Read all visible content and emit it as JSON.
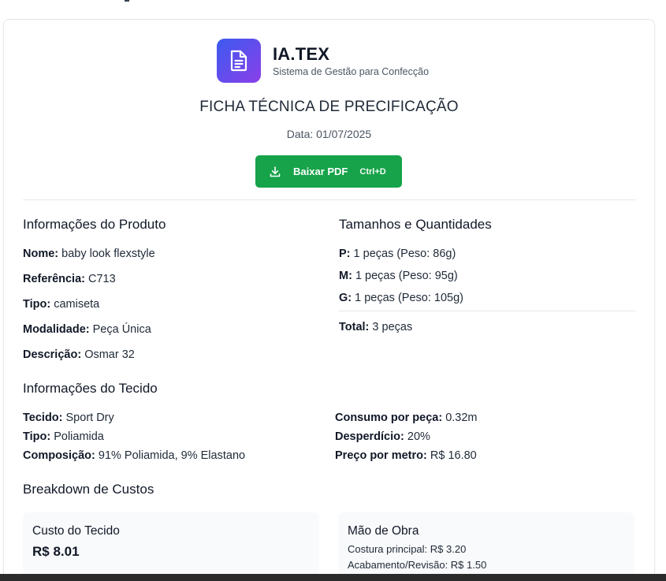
{
  "brand": {
    "name": "IA.TEX",
    "subtitle": "Sistema de Gestão para Confecção",
    "gradient_start": "#3b5bf0",
    "gradient_end": "#8b3fe8",
    "icon": "document-icon"
  },
  "document": {
    "title": "FICHA TÉCNICA DE PRECIFICAÇÃO",
    "date": "Data: 01/07/2025"
  },
  "actions": {
    "download_label": "Baixar PDF",
    "download_shortcut": "Ctrl+D",
    "download_icon": "download-icon",
    "button_color": "#16a34a"
  },
  "product": {
    "section_title": "Informações do Produto",
    "fields": [
      {
        "label": "Nome:",
        "value": "baby look flexstyle"
      },
      {
        "label": "Referência:",
        "value": "C713"
      },
      {
        "label": "Tipo:",
        "value": "camiseta"
      },
      {
        "label": "Modalidade:",
        "value": "Peça Única"
      },
      {
        "label": "Descrição:",
        "value": "Osmar 32"
      }
    ]
  },
  "sizes": {
    "section_title": "Tamanhos e Quantidades",
    "items": [
      {
        "label": "P:",
        "value": "1 peças (Peso: 86g)"
      },
      {
        "label": "M:",
        "value": "1 peças (Peso: 95g)"
      },
      {
        "label": "G:",
        "value": "1 peças (Peso: 105g)"
      }
    ],
    "total_label": "Total:",
    "total_value": "3 peças"
  },
  "fabric": {
    "section_title": "Informações do Tecido",
    "left": [
      {
        "label": "Tecido:",
        "value": "Sport Dry"
      },
      {
        "label": "Tipo:",
        "value": "Poliamida"
      },
      {
        "label": "Composição:",
        "value": "91% Poliamida, 9% Elastano"
      }
    ],
    "right": [
      {
        "label": "Consumo por peça:",
        "value": "0.32m"
      },
      {
        "label": "Desperdício:",
        "value": "20%"
      },
      {
        "label": "Preço por metro:",
        "value": "R$ 16.80"
      }
    ]
  },
  "costs": {
    "section_title": "Breakdown de Custos",
    "fabric_cost": {
      "title": "Custo do Tecido",
      "value": "R$ 8.01"
    },
    "labor": {
      "title": "Mão de Obra",
      "lines": [
        "Costura principal: R$ 3.20",
        "Acabamento/Revisão: R$ 1.50"
      ]
    }
  }
}
